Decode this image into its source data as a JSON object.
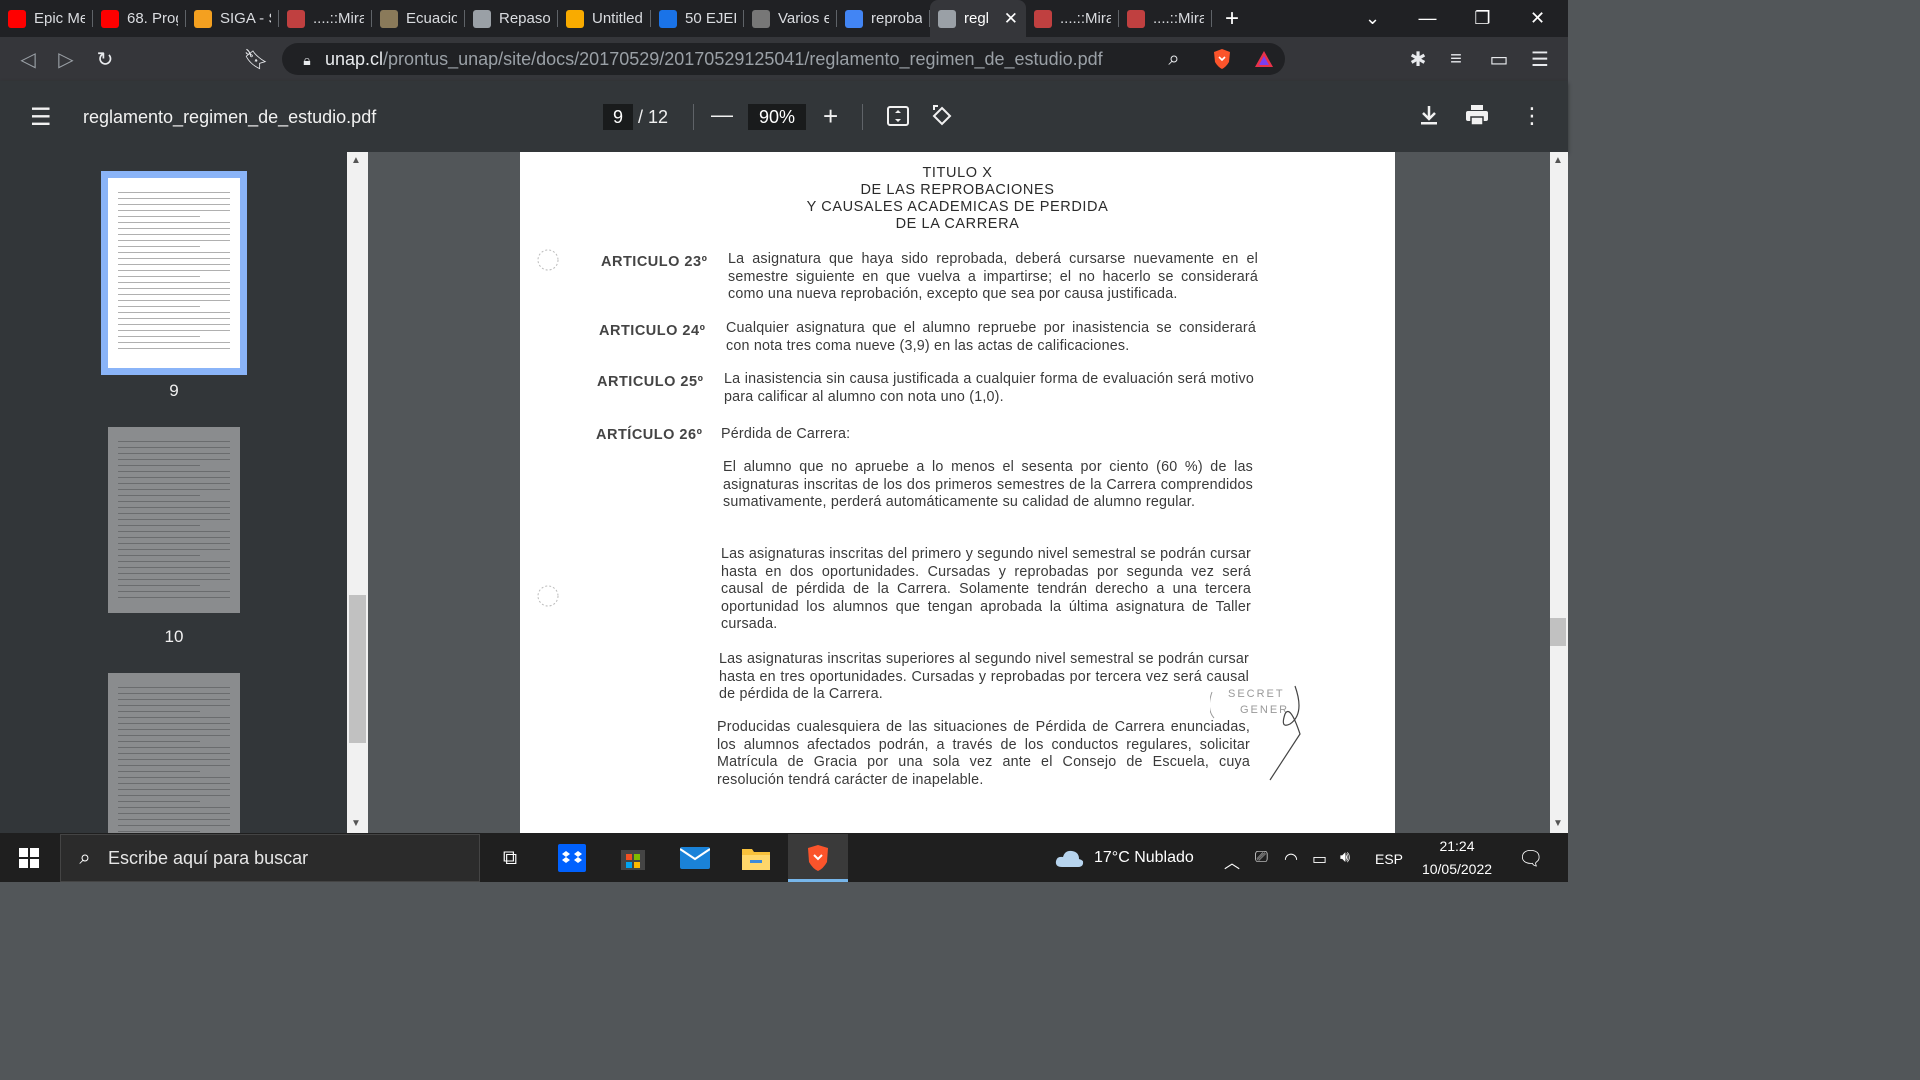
{
  "tabs": [
    {
      "title": "Epic Me",
      "icon": "youtube-icon",
      "color": "#ff0000"
    },
    {
      "title": "68. Prog",
      "icon": "youtube-icon",
      "color": "#ff0000"
    },
    {
      "title": "SIGA - S",
      "icon": "siga-icon",
      "color": "#f4a020"
    },
    {
      "title": "....::Mira",
      "icon": "site-icon",
      "color": "#c04040"
    },
    {
      "title": "Ecuacio",
      "icon": "site-icon",
      "color": "#8a7a5a"
    },
    {
      "title": "Repaso",
      "icon": "globe-icon",
      "color": "#9aa0a6"
    },
    {
      "title": "Untitled",
      "icon": "colab-icon",
      "color": "#f9ab00"
    },
    {
      "title": "50 EJER",
      "icon": "document-icon",
      "color": "#1a73e8"
    },
    {
      "title": "Varios e",
      "icon": "site-icon",
      "color": "#777"
    },
    {
      "title": "reproba",
      "icon": "google-icon",
      "color": "#4285f4"
    },
    {
      "title": "regl",
      "icon": "pdf-icon",
      "color": "#9aa0a6",
      "active": true
    },
    {
      "title": "....::Mira",
      "icon": "site-icon",
      "color": "#c04040"
    },
    {
      "title": "....::Mira",
      "icon": "site-icon",
      "color": "#c04040"
    }
  ],
  "url": {
    "host": "unap.cl",
    "path": "/prontus_unap/site/docs/20170529/20170529125041/reglamento_regimen_de_estudio.pdf"
  },
  "pdf": {
    "filename": "reglamento_regimen_de_estudio.pdf",
    "current_page": "9",
    "total_pages": "/ 12",
    "zoom": "90%"
  },
  "thumbnails": [
    {
      "label": "9",
      "selected": true
    },
    {
      "label": "10",
      "selected": false
    }
  ],
  "document": {
    "heading": [
      "TITULO X",
      "DE LAS REPROBACIONES",
      "Y CAUSALES ACADEMICAS DE  PERDIDA",
      "DE LA CARRERA"
    ],
    "articles": [
      {
        "label": "ARTICULO 23º",
        "text": "La asignatura que haya sido reprobada, deberá cursarse nuevamente en el semestre siguiente en que vuelva a impartirse; el no hacerlo se considerará como una nueva reprobación, excepto que sea por causa justificada."
      },
      {
        "label": "ARTICULO 24º",
        "text": "Cualquier asignatura que el alumno repruebe por inasistencia se considerará con nota tres coma nueve  (3,9) en las actas de calificaciones."
      },
      {
        "label": "ARTICULO 25º",
        "text": "La inasistencia sin causa justificada a cualquier forma de evaluación  será motivo para calificar al alumno con nota uno (1,0)."
      },
      {
        "label": "ARTÍCULO 26º",
        "text": "Pérdida de Carrera:"
      }
    ],
    "paragraphs": [
      "El alumno que no apruebe a lo menos el sesenta por ciento (60 %) de  las asignaturas inscritas de los dos primeros semestres de la Carrera comprendidos sumativamente, perderá automáticamente su calidad de alumno regular.",
      "Las asignaturas inscritas del primero y segundo nivel semestral  se podrán cursar hasta en dos oportunidades. Cursadas y reprobadas por segunda vez será causal de pérdida de la Carrera. Solamente tendrán derecho a una tercera oportunidad los alumnos que tengan aprobada la última asignatura de Taller cursada.",
      "Las asignaturas inscritas superiores al segundo nivel semestral se podrán cursar hasta en tres oportunidades. Cursadas y reprobadas por tercera vez será causal de pérdida de la Carrera.",
      "Producidas cualesquiera de las situaciones de Pérdida de Carrera enunciadas, los alumnos afectados podrán, a través de los conductos regulares, solicitar Matrícula de Gracia por una sola vez ante el Consejo de Escuela, cuya resolución tendrá carácter de inapelable."
    ],
    "stamp": [
      "SECRET",
      "GENER"
    ]
  },
  "taskbar": {
    "search_placeholder": "Escribe aquí para buscar",
    "weather": "17°C  Nublado",
    "language": "ESP",
    "time": "21:24",
    "date": "10/05/2022"
  }
}
